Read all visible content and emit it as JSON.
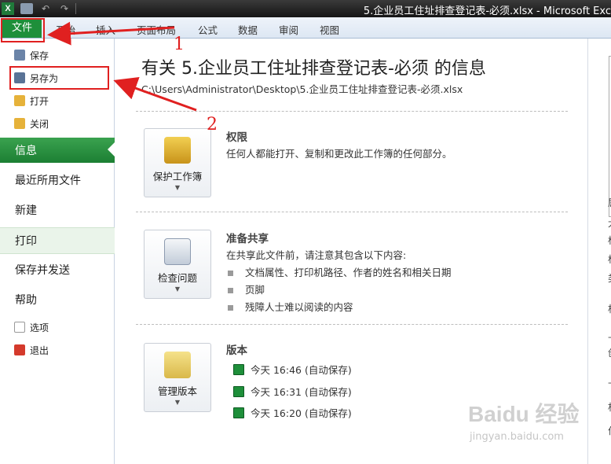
{
  "window": {
    "title": "5.企业员工住址排查登记表-必须.xlsx  -  Microsoft Exc",
    "app_logo": "X"
  },
  "qat": {
    "undo_glyph": "↶",
    "redo_glyph": "↷"
  },
  "ribbon": {
    "file_tab": "文件",
    "tabs": [
      "开始",
      "插入",
      "页面布局",
      "公式",
      "数据",
      "审阅",
      "视图"
    ]
  },
  "backstage": {
    "small_items": [
      {
        "label": "保存",
        "icon": "save-icon"
      },
      {
        "label": "另存为",
        "icon": "save-as-icon"
      },
      {
        "label": "打开",
        "icon": "open-folder-icon"
      },
      {
        "label": "关闭",
        "icon": "close-folder-icon"
      }
    ],
    "big_items": [
      "信息",
      "最近所用文件",
      "新建",
      "打印",
      "保存并发送",
      "帮助"
    ],
    "bottom_items": [
      {
        "label": "选项",
        "icon": "options-icon"
      },
      {
        "label": "退出",
        "icon": "exit-icon"
      }
    ]
  },
  "info": {
    "heading": "有关 5.企业员工住址排查登记表-必须 的信息",
    "path": "C:\\Users\\Administrator\\Desktop\\5.企业员工住址排查登记表-必须.xlsx",
    "permissions": {
      "button": "保护工作簿",
      "title": "权限",
      "desc": "任何人都能打开、复制和更改此工作簿的任何部分。"
    },
    "prepare": {
      "button": "检查问题",
      "title": "准备共享",
      "desc": "在共享此文件前，请注意其包含以下内容:",
      "bullets": [
        "文档属性、打印机路径、作者的姓名和相关日期",
        "页脚",
        "残障人士难以阅读的内容"
      ]
    },
    "versions": {
      "button": "管理版本",
      "title": "版本",
      "items": [
        "今天 16:46 (自动保存)",
        "今天 16:31 (自动保存)",
        "今天 16:20 (自动保存)"
      ]
    }
  },
  "right_pane": {
    "chars": [
      "属",
      "大",
      "标",
      "标",
      "类",
      "相",
      "上",
      "创",
      "上",
      "相",
      "作"
    ]
  },
  "annotations": {
    "num1": "1",
    "num2": "2"
  },
  "watermark": {
    "logo": "Baidu 经验",
    "url": "jingyan.baidu.com"
  },
  "colors": {
    "file_tab": "#1e8f3a",
    "active_item": "#2a9443",
    "annotation": "#e02020"
  }
}
